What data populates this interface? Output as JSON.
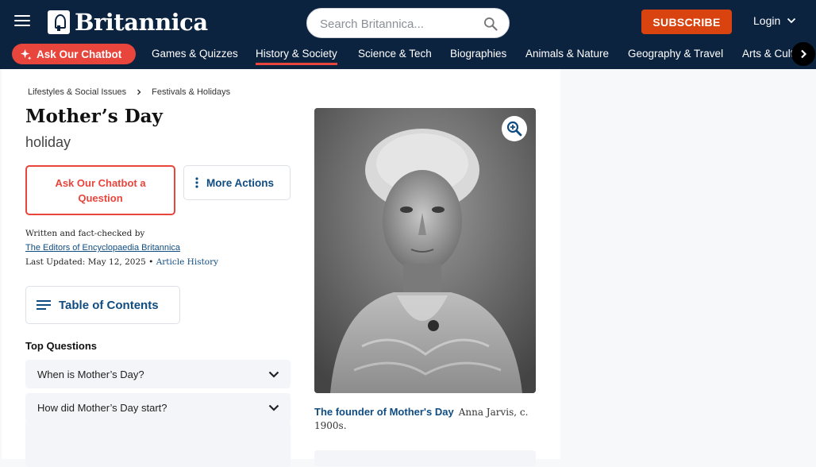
{
  "header": {
    "logo_text": "Britannica",
    "search_placeholder": "Search Britannica...",
    "subscribe_label": "SUBSCRIBE",
    "login_label": "Login",
    "chatbot_pill_label": "Ask Our Chatbot",
    "nav": [
      {
        "label": "Games & Quizzes"
      },
      {
        "label": "History & Society",
        "active": true
      },
      {
        "label": "Science & Tech"
      },
      {
        "label": "Biographies"
      },
      {
        "label": "Animals & Nature"
      },
      {
        "label": "Geography & Travel"
      },
      {
        "label": "Arts & Culture"
      }
    ]
  },
  "article": {
    "breadcrumb": [
      "Lifestyles & Social Issues",
      "Festivals & Holidays"
    ],
    "title": "Mother’s Day",
    "subtitle": "holiday",
    "ask_chatbot_label": "Ask Our Chatbot a Question",
    "more_actions_label": "More Actions",
    "written_by_label": "Written and fact-checked by",
    "author": "The Editors of Encyclopaedia Britannica",
    "last_updated_label": "Last Updated: May 12, 2025",
    "bullet": "•",
    "article_history_label": "Article History",
    "toc_label": "Table of Contents",
    "top_questions_label": "Top Questions",
    "questions": [
      "When is Mother’s Day?",
      "How did Mother’s Day start?"
    ]
  },
  "figure": {
    "caption_title": "The founder of Mother's Day",
    "caption_text": "Anna Jarvis, c. 1900s."
  },
  "colors": {
    "header_bg": "#0c2340",
    "accent_red": "#e8453c",
    "subscribe_orange": "#d9430f",
    "link_blue": "#0f4c81"
  },
  "icons": [
    "menu-icon",
    "logo-icon",
    "search-icon",
    "chevron-down-icon",
    "sparkle-icon",
    "chevron-right-icon",
    "more-vert-icon",
    "toc-list-icon",
    "zoom-in-icon"
  ]
}
